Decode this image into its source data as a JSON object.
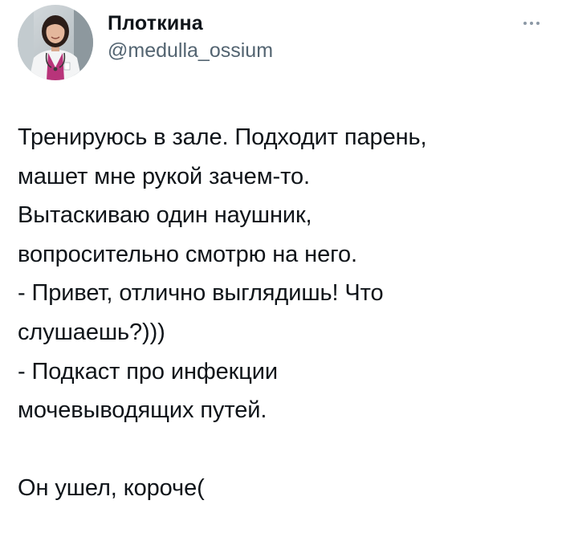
{
  "author": {
    "display_name": "Плоткина",
    "handle": "@medulla_ossium",
    "avatar_icon": "doctor-avatar-photo"
  },
  "menu": {
    "icon": "more-horizontal-icon"
  },
  "tweet": {
    "lines": [
      "Тренируюсь в зале. Подходит парень,",
      "машет мне рукой зачем-то.",
      "Вытаскиваю один наушник,",
      "вопросительно смотрю на него.",
      "- Привет, отлично выглядишь! Что",
      "слушаешь?)))",
      "- Подкаст про инфекции",
      "мочевыводящих путей.",
      "",
      "Он ушел, короче("
    ]
  },
  "colors": {
    "text": "#0f1419",
    "secondary": "#536471",
    "background": "#ffffff"
  }
}
